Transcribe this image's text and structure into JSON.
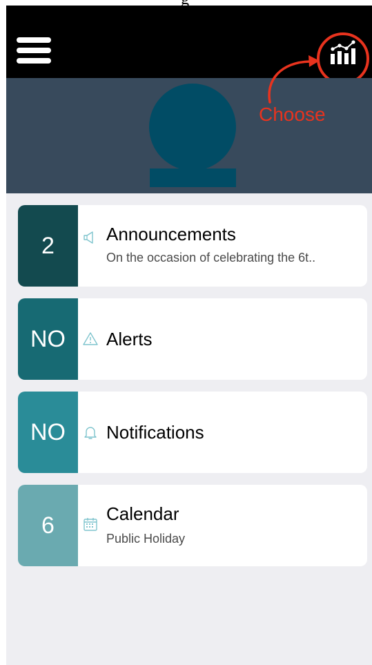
{
  "header": {
    "menu_icon": "hamburger-menu-icon",
    "chart_icon": "bar-chart-icon"
  },
  "annotation": {
    "label": "Choose",
    "color": "#e8331e"
  },
  "cards": [
    {
      "badge": "2",
      "icon": "megaphone-icon",
      "title": "Announcements",
      "subtitle": "On the occasion of celebrating the 6t..",
      "badge_color": "#134a4f"
    },
    {
      "badge": "NO",
      "icon": "warning-icon",
      "title": "Alerts",
      "subtitle": "",
      "badge_color": "#176a73"
    },
    {
      "badge": "NO",
      "icon": "bell-icon",
      "title": "Notifications",
      "subtitle": "",
      "badge_color": "#2a8c98"
    },
    {
      "badge": "6",
      "icon": "calendar-icon",
      "title": "Calendar",
      "subtitle": "Public Holiday",
      "badge_color": "#6aaab0"
    }
  ],
  "colors": {
    "accent_icon": "#7ec4cd",
    "profile_bg": "#384a5c",
    "avatar": "#014c65"
  }
}
